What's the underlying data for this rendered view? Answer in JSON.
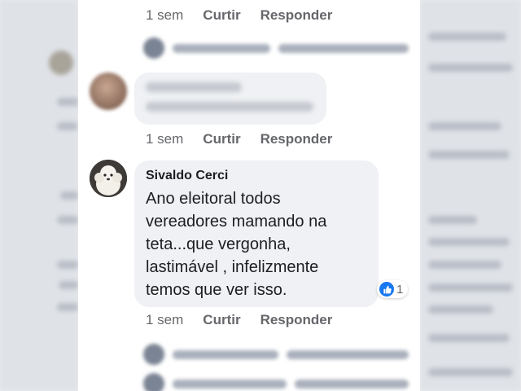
{
  "comments": [
    {
      "author": "",
      "text": "",
      "actions": {
        "time": "1 sem",
        "like": "Curtir",
        "reply": "Responder"
      }
    },
    {
      "author": "Sivaldo Cerci",
      "text": "Ano eleitoral todos\nvereadores mamando na\nteta...que vergonha,\nlastimável , infelizmente\ntemos que ver isso.",
      "reactions": {
        "icon": "like-icon",
        "count": "1"
      },
      "actions": {
        "time": "1 sem",
        "like": "Curtir",
        "reply": "Responder"
      }
    }
  ],
  "top_actions": {
    "time": "1 sem",
    "like": "Curtir",
    "reply": "Responder"
  },
  "colors": {
    "like_blue": "#1877f2",
    "bubble": "#eff1f4",
    "meta_gray": "#65676b"
  }
}
